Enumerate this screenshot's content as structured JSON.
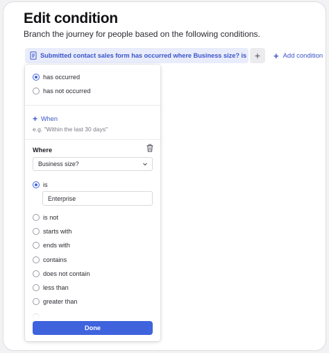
{
  "header": {
    "title": "Edit condition",
    "subtitle": "Branch the journey for people based on the following conditions."
  },
  "condition_chip": {
    "label": "Submitted contact sales form has occurred where Business size? is Enterprise",
    "icon": "document-icon"
  },
  "toolbar": {
    "add_icon": "plus-icon",
    "add_condition_label": "Add condition"
  },
  "panel": {
    "occurrence_options": [
      {
        "label": "has occurred",
        "selected": true
      },
      {
        "label": "has not occurred",
        "selected": false
      }
    ],
    "when_label": "When",
    "when_placeholder": "e.g. \"Within the last 30 days\"",
    "where_label": "Where",
    "property_select_value": "Business size?",
    "operators": [
      {
        "label": "is",
        "selected": true
      },
      {
        "label": "is not",
        "selected": false
      },
      {
        "label": "starts with",
        "selected": false
      },
      {
        "label": "ends with",
        "selected": false
      },
      {
        "label": "contains",
        "selected": false
      },
      {
        "label": "does not contain",
        "selected": false
      },
      {
        "label": "less than",
        "selected": false
      },
      {
        "label": "greater than",
        "selected": false
      }
    ],
    "value_input": "Enterprise",
    "done_label": "Done"
  },
  "colors": {
    "accent": "#3e63dd",
    "chip_bg": "#e9ecfb",
    "chip_text": "#3a55c9"
  }
}
